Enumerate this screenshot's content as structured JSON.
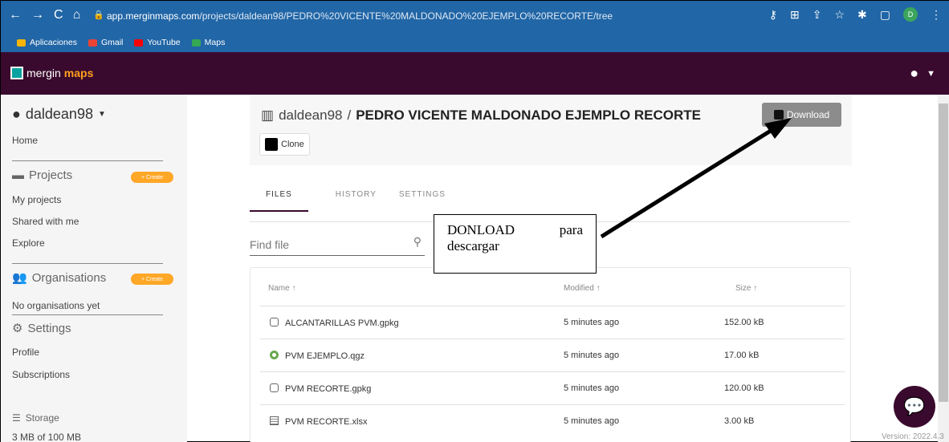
{
  "browser": {
    "url_host": "app.merginmaps.com",
    "url_path": "/projects/daldean98/PEDRO%20VICENTE%20MALDONADO%20EJEMPLO%20RECORTE/tree",
    "avatar_letter": "D",
    "bookmarks": [
      "Aplicaciones",
      "Gmail",
      "YouTube",
      "Maps"
    ]
  },
  "app": {
    "logo_prefix": "mergin",
    "logo_suffix": "maps"
  },
  "sidebar": {
    "username": "daldean98",
    "home": "Home",
    "projects": "Projects",
    "create": "+ Create",
    "my_projects": "My projects",
    "shared": "Shared with me",
    "explore": "Explore",
    "organisations": "Organisations",
    "no_orgs": "No organisations yet",
    "settings": "Settings",
    "profile": "Profile",
    "subscriptions": "Subscriptions",
    "storage": "Storage",
    "storage_used": "3 MB of 100 MB"
  },
  "project": {
    "owner": "daldean98",
    "separator": "/",
    "name": "PEDRO VICENTE MALDONADO EJEMPLO RECORTE",
    "clone": "Clone",
    "download": "Download"
  },
  "tabs": [
    "FILES",
    "HISTORY",
    "SETTINGS"
  ],
  "search": {
    "placeholder": "Find file"
  },
  "annotation": {
    "word1": "DONLOAD",
    "word2": "para",
    "word3": "descargar"
  },
  "table": {
    "headers": [
      "Name ↑",
      "Modified ↑",
      "Size ↑"
    ],
    "rows": [
      {
        "name": "ALCANTARILLAS PVM.gpkg",
        "modified": "5 minutes ago",
        "size": "152.00 kB"
      },
      {
        "name": "PVM EJEMPLO.qgz",
        "modified": "5 minutes ago",
        "size": "17.00 kB"
      },
      {
        "name": "PVM RECORTE.gpkg",
        "modified": "5 minutes ago",
        "size": "120.00 kB"
      },
      {
        "name": "PVM RECORTE.xlsx",
        "modified": "5 minutes ago",
        "size": "3.00 kB"
      }
    ]
  },
  "version": "Version: 2022.4.3"
}
